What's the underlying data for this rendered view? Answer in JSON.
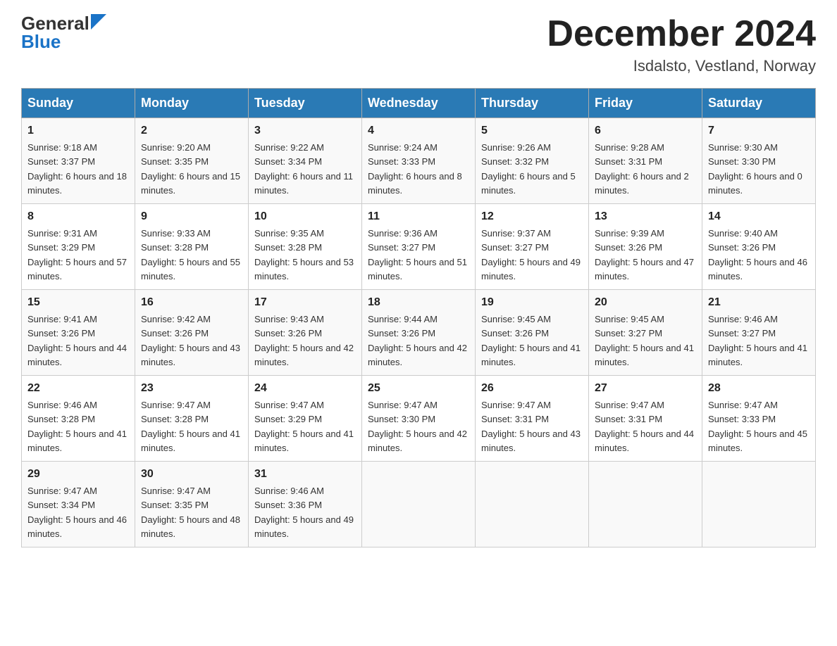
{
  "header": {
    "logo_general": "General",
    "logo_blue": "Blue",
    "title": "December 2024",
    "subtitle": "Isdalsto, Vestland, Norway"
  },
  "weekdays": [
    "Sunday",
    "Monday",
    "Tuesday",
    "Wednesday",
    "Thursday",
    "Friday",
    "Saturday"
  ],
  "weeks": [
    [
      {
        "day": "1",
        "sunrise": "9:18 AM",
        "sunset": "3:37 PM",
        "daylight": "6 hours and 18 minutes."
      },
      {
        "day": "2",
        "sunrise": "9:20 AM",
        "sunset": "3:35 PM",
        "daylight": "6 hours and 15 minutes."
      },
      {
        "day": "3",
        "sunrise": "9:22 AM",
        "sunset": "3:34 PM",
        "daylight": "6 hours and 11 minutes."
      },
      {
        "day": "4",
        "sunrise": "9:24 AM",
        "sunset": "3:33 PM",
        "daylight": "6 hours and 8 minutes."
      },
      {
        "day": "5",
        "sunrise": "9:26 AM",
        "sunset": "3:32 PM",
        "daylight": "6 hours and 5 minutes."
      },
      {
        "day": "6",
        "sunrise": "9:28 AM",
        "sunset": "3:31 PM",
        "daylight": "6 hours and 2 minutes."
      },
      {
        "day": "7",
        "sunrise": "9:30 AM",
        "sunset": "3:30 PM",
        "daylight": "6 hours and 0 minutes."
      }
    ],
    [
      {
        "day": "8",
        "sunrise": "9:31 AM",
        "sunset": "3:29 PM",
        "daylight": "5 hours and 57 minutes."
      },
      {
        "day": "9",
        "sunrise": "9:33 AM",
        "sunset": "3:28 PM",
        "daylight": "5 hours and 55 minutes."
      },
      {
        "day": "10",
        "sunrise": "9:35 AM",
        "sunset": "3:28 PM",
        "daylight": "5 hours and 53 minutes."
      },
      {
        "day": "11",
        "sunrise": "9:36 AM",
        "sunset": "3:27 PM",
        "daylight": "5 hours and 51 minutes."
      },
      {
        "day": "12",
        "sunrise": "9:37 AM",
        "sunset": "3:27 PM",
        "daylight": "5 hours and 49 minutes."
      },
      {
        "day": "13",
        "sunrise": "9:39 AM",
        "sunset": "3:26 PM",
        "daylight": "5 hours and 47 minutes."
      },
      {
        "day": "14",
        "sunrise": "9:40 AM",
        "sunset": "3:26 PM",
        "daylight": "5 hours and 46 minutes."
      }
    ],
    [
      {
        "day": "15",
        "sunrise": "9:41 AM",
        "sunset": "3:26 PM",
        "daylight": "5 hours and 44 minutes."
      },
      {
        "day": "16",
        "sunrise": "9:42 AM",
        "sunset": "3:26 PM",
        "daylight": "5 hours and 43 minutes."
      },
      {
        "day": "17",
        "sunrise": "9:43 AM",
        "sunset": "3:26 PM",
        "daylight": "5 hours and 42 minutes."
      },
      {
        "day": "18",
        "sunrise": "9:44 AM",
        "sunset": "3:26 PM",
        "daylight": "5 hours and 42 minutes."
      },
      {
        "day": "19",
        "sunrise": "9:45 AM",
        "sunset": "3:26 PM",
        "daylight": "5 hours and 41 minutes."
      },
      {
        "day": "20",
        "sunrise": "9:45 AM",
        "sunset": "3:27 PM",
        "daylight": "5 hours and 41 minutes."
      },
      {
        "day": "21",
        "sunrise": "9:46 AM",
        "sunset": "3:27 PM",
        "daylight": "5 hours and 41 minutes."
      }
    ],
    [
      {
        "day": "22",
        "sunrise": "9:46 AM",
        "sunset": "3:28 PM",
        "daylight": "5 hours and 41 minutes."
      },
      {
        "day": "23",
        "sunrise": "9:47 AM",
        "sunset": "3:28 PM",
        "daylight": "5 hours and 41 minutes."
      },
      {
        "day": "24",
        "sunrise": "9:47 AM",
        "sunset": "3:29 PM",
        "daylight": "5 hours and 41 minutes."
      },
      {
        "day": "25",
        "sunrise": "9:47 AM",
        "sunset": "3:30 PM",
        "daylight": "5 hours and 42 minutes."
      },
      {
        "day": "26",
        "sunrise": "9:47 AM",
        "sunset": "3:31 PM",
        "daylight": "5 hours and 43 minutes."
      },
      {
        "day": "27",
        "sunrise": "9:47 AM",
        "sunset": "3:31 PM",
        "daylight": "5 hours and 44 minutes."
      },
      {
        "day": "28",
        "sunrise": "9:47 AM",
        "sunset": "3:33 PM",
        "daylight": "5 hours and 45 minutes."
      }
    ],
    [
      {
        "day": "29",
        "sunrise": "9:47 AM",
        "sunset": "3:34 PM",
        "daylight": "5 hours and 46 minutes."
      },
      {
        "day": "30",
        "sunrise": "9:47 AM",
        "sunset": "3:35 PM",
        "daylight": "5 hours and 48 minutes."
      },
      {
        "day": "31",
        "sunrise": "9:46 AM",
        "sunset": "3:36 PM",
        "daylight": "5 hours and 49 minutes."
      },
      null,
      null,
      null,
      null
    ]
  ]
}
